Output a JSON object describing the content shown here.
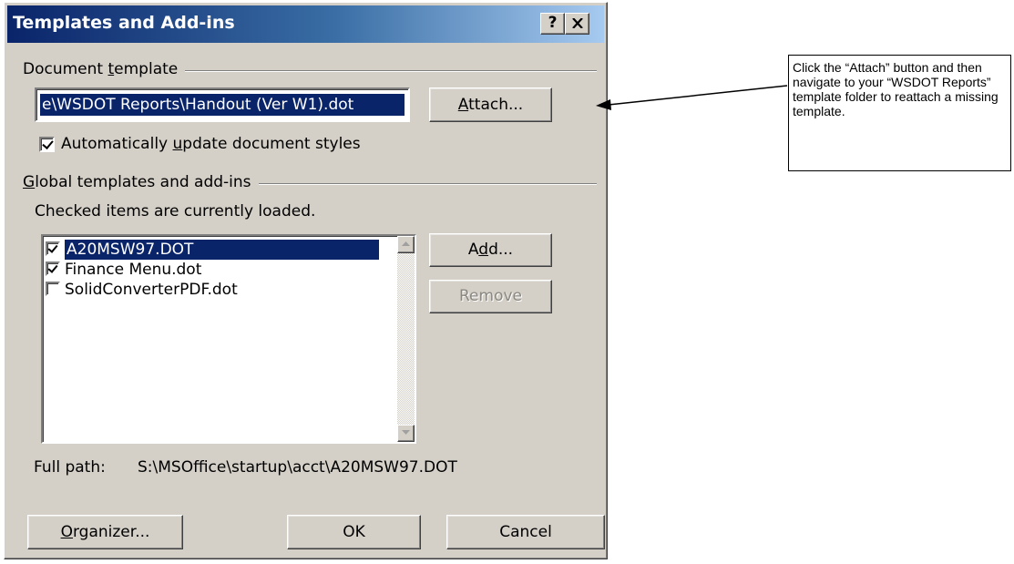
{
  "dialog": {
    "title": "Templates and Add-ins",
    "help_label": "?",
    "close_label": "✕"
  },
  "document_template": {
    "group_prefix": "Document ",
    "group_accel": "t",
    "group_suffix": "emplate",
    "value": "e\\WSDOT Reports\\Handout (Ver W1).dot",
    "attach_accel": "A",
    "attach_rest": "ttach...",
    "auto_update_prefix": "Automatically ",
    "auto_update_accel": "u",
    "auto_update_suffix": "pdate document styles",
    "auto_update_checked": true
  },
  "global_templates": {
    "group_accel": "G",
    "group_rest": "lobal templates and add-ins",
    "hint": "Checked items are currently loaded.",
    "items": [
      {
        "label": "A20MSW97.DOT",
        "checked": true,
        "selected": true
      },
      {
        "label": "Finance Menu.dot",
        "checked": true,
        "selected": false
      },
      {
        "label": "SolidConverterPDF.dot",
        "checked": false,
        "selected": false
      }
    ],
    "add_prefix": "A",
    "add_accel": "d",
    "add_suffix": "d...",
    "remove_label": "Remove",
    "full_path_label": "Full path:",
    "full_path_value": "S:\\MSOffice\\startup\\acct\\A20MSW97.DOT"
  },
  "footer": {
    "organizer_accel": "O",
    "organizer_rest": "rganizer...",
    "ok_label": "OK",
    "cancel_label": "Cancel"
  },
  "callout": {
    "text": "Click the “Attach” button and then navigate to your “WSDOT Reports” template folder to reattach a missing template."
  }
}
